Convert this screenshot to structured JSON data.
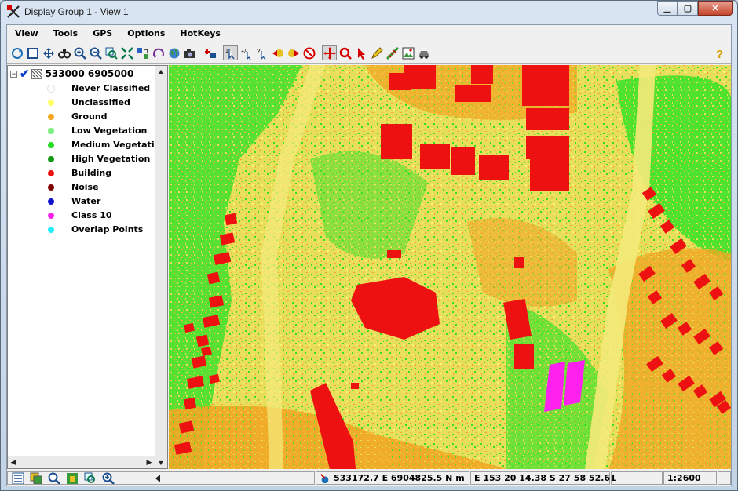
{
  "window": {
    "title": "Display Group 1 - View 1"
  },
  "menu": [
    "View",
    "Tools",
    "GPS",
    "Options",
    "HotKeys"
  ],
  "toolbar": {
    "tools": [
      "redraw-icon",
      "full-view-icon",
      "pan-icon",
      "binoculars-icon",
      "zoom-in-icon",
      "zoom-out-icon",
      "zoom-box-icon",
      "zoom-extents-icon",
      "sync-icon",
      "rotate-icon",
      "globe-icon",
      "camera-icon",
      "add-layer-icon",
      "select-one-icon",
      "select-multi-icon",
      "query-icon",
      "prev-icon",
      "next-icon",
      "no-select-icon",
      "cross-move-icon",
      "zoom-target-icon",
      "pointer-icon",
      "pencil-icon",
      "measure-icon",
      "image-icon",
      "car-icon",
      "help-icon"
    ]
  },
  "tree": {
    "root_label": "533000 6905000",
    "classes": [
      {
        "label": "Never Classified",
        "color": "#ffffff"
      },
      {
        "label": "Unclassified",
        "color": "#ffff66"
      },
      {
        "label": "Ground",
        "color": "#f5a623"
      },
      {
        "label": "Low Vegetation",
        "color": "#7cf07c"
      },
      {
        "label": "Medium Vegetation",
        "color": "#22dd22"
      },
      {
        "label": "High Vegetation",
        "color": "#149a14"
      },
      {
        "label": "Building",
        "color": "#ee1111"
      },
      {
        "label": "Noise",
        "color": "#800000"
      },
      {
        "label": "Water",
        "color": "#1010cc"
      },
      {
        "label": "Class 10",
        "color": "#ff22ee"
      },
      {
        "label": "Overlap Points",
        "color": "#22eeff"
      }
    ]
  },
  "status": {
    "coords_map": "533172.7 E  6904825.5 N m",
    "coords_geo": "E 153 20 14.38  S 27 58 52.61",
    "scale": "1:2600"
  }
}
